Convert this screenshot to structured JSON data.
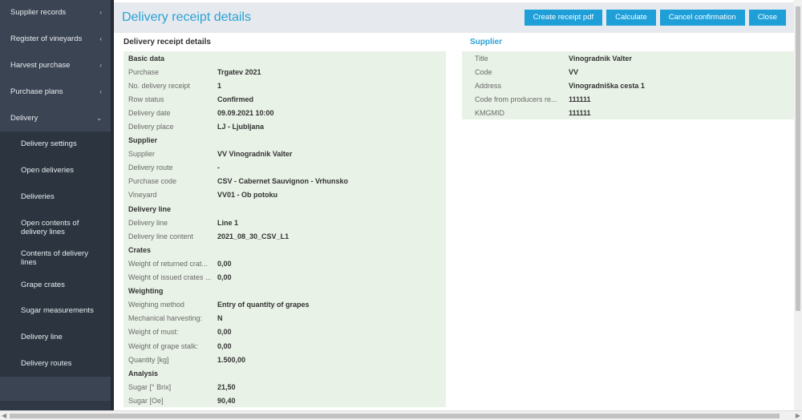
{
  "sidebar": {
    "items": [
      {
        "label": "Supplier records",
        "chevron": "‹"
      },
      {
        "label": "Register of vineyards",
        "chevron": "‹"
      },
      {
        "label": "Harvest purchase",
        "chevron": "‹"
      },
      {
        "label": "Purchase plans",
        "chevron": "‹"
      },
      {
        "label": "Delivery",
        "chevron": "⌄"
      }
    ],
    "subitems": [
      {
        "label": "Delivery settings"
      },
      {
        "label": "Open deliveries"
      },
      {
        "label": "Deliveries"
      },
      {
        "label": "Open contents of delivery lines"
      },
      {
        "label": "Contents of delivery lines"
      },
      {
        "label": "Grape crates"
      },
      {
        "label": "Sugar measurements"
      },
      {
        "label": "Delivery line"
      },
      {
        "label": "Delivery routes"
      }
    ]
  },
  "header": {
    "title": "Delivery receipt details",
    "buttons": {
      "create_pdf": "Create receipt pdf",
      "calculate": "Calculate",
      "cancel_confirmation": "Cancel confirmation",
      "close": "Close"
    }
  },
  "left": {
    "title": "Delivery receipt details",
    "rows": [
      {
        "group": "Basic data"
      },
      {
        "label": "Purchase",
        "value": "Trgatev 2021"
      },
      {
        "label": "No. delivery receipt",
        "value": "1"
      },
      {
        "label": "Row status",
        "value": "Confirmed"
      },
      {
        "label": "Delivery date",
        "value": "09.09.2021 10:00"
      },
      {
        "label": "Delivery place",
        "value": "LJ - Ljubljana"
      },
      {
        "group": "Supplier"
      },
      {
        "label": "Supplier",
        "value": "VV Vinogradnik Valter"
      },
      {
        "label": "Delivery route",
        "value": "-"
      },
      {
        "label": "Purchase code",
        "value": "CSV - Cabernet Sauvignon - Vrhunsko"
      },
      {
        "label": "Vineyard",
        "value": "VV01 - Ob potoku"
      },
      {
        "group": "Delivery line"
      },
      {
        "label": "Delivery line",
        "value": "Line 1"
      },
      {
        "label": "Delivery line content",
        "value": "2021_08_30_CSV_L1"
      },
      {
        "group": "Crates"
      },
      {
        "label": "Weight of returned crat...",
        "value": "0,00"
      },
      {
        "label": "Weight of issued crates ...",
        "value": "0,00"
      },
      {
        "group": "Weighting"
      },
      {
        "label": "Weighing method",
        "value": "Entry of quantity of grapes"
      },
      {
        "label": "Mechanical harvesting:",
        "value": "N"
      },
      {
        "label": "Weight of must:",
        "value": "0,00"
      },
      {
        "label": "Weight of grape stalk:",
        "value": "0,00"
      },
      {
        "label": "Quantity [kg]",
        "value": "1.500,00"
      },
      {
        "group": "Analysis"
      },
      {
        "label": "Sugar [° Brix]",
        "value": "21,50"
      },
      {
        "label": "Sugar [Oe]",
        "value": "90,40"
      }
    ]
  },
  "right": {
    "title": "Supplier",
    "rows": [
      {
        "label": "Title",
        "value": "Vinogradnik Valter"
      },
      {
        "label": "Code",
        "value": "VV"
      },
      {
        "label": "Address",
        "value": "Vinogradniška cesta 1"
      },
      {
        "label": "Code from producers re...",
        "value": "111111"
      },
      {
        "label": "KMGMID",
        "value": "111111"
      }
    ]
  },
  "colors": {
    "sidebar_bg": "#2f3844",
    "accent": "#1e9fd8",
    "title": "#2aa2d6",
    "grid_bg": "#e8f2e6"
  }
}
